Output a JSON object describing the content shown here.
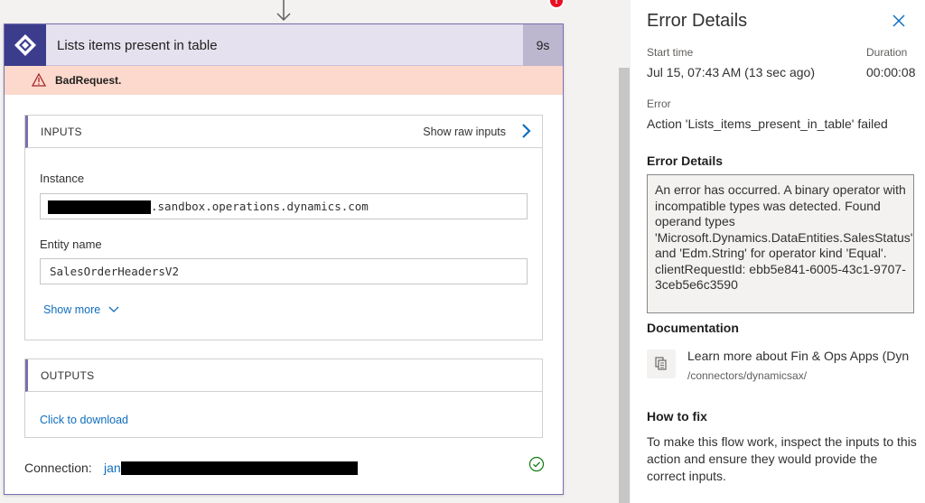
{
  "action_card": {
    "title": "Lists items present in table",
    "duration": "9s",
    "error_indicator": "!",
    "error_label": "BadRequest.",
    "inputs": {
      "section_title": "INPUTS",
      "show_raw_label": "Show raw inputs",
      "instance_label": "Instance",
      "instance_value": ".sandbox.operations.dynamics.com",
      "entity_label": "Entity name",
      "entity_value": "SalesOrderHeadersV2",
      "show_more_label": "Show more"
    },
    "outputs": {
      "section_title": "OUTPUTS",
      "download_label": "Click to download"
    },
    "connection": {
      "label": "Connection:",
      "value": "jan"
    }
  },
  "error_panel": {
    "title": "Error Details",
    "start_time_label": "Start time",
    "start_time_value": "Jul 15, 07:43 AM (13 sec ago)",
    "duration_label": "Duration",
    "duration_value": "00:00:08",
    "error_label": "Error",
    "error_value": "Action 'Lists_items_present_in_table' failed",
    "details_heading": "Error Details",
    "details_text": "An error has occurred.  A binary operator with incompatible types was detected. Found operand types 'Microsoft.Dynamics.DataEntities.SalesStatus' and 'Edm.String' for operator kind 'Equal'.",
    "client_request_id": "clientRequestId: ebb5e841-6005-43c1-9707-3ceb5e6c3590",
    "documentation_heading": "Documentation",
    "doc_link_text": "Learn more about Fin & Ops Apps (Dyn",
    "doc_link_path": "/connectors/dynamicsax/",
    "how_to_fix_heading": "How to fix",
    "how_to_fix_text": "To make this flow work, inspect the inputs to this action and ensure they would provide the correct inputs."
  },
  "icons": [
    "down-arrow-icon",
    "power-apps-icon",
    "warning-icon",
    "chevron-right-icon",
    "chevron-down-icon",
    "success-check-icon",
    "close-icon",
    "copy-doc-icon"
  ],
  "colors": {
    "header_bg": "#e6e1ee",
    "error_banner_bg": "#fcd9cc",
    "error_dot": "#e81123",
    "link": "#106ebe",
    "success": "#107c10"
  }
}
